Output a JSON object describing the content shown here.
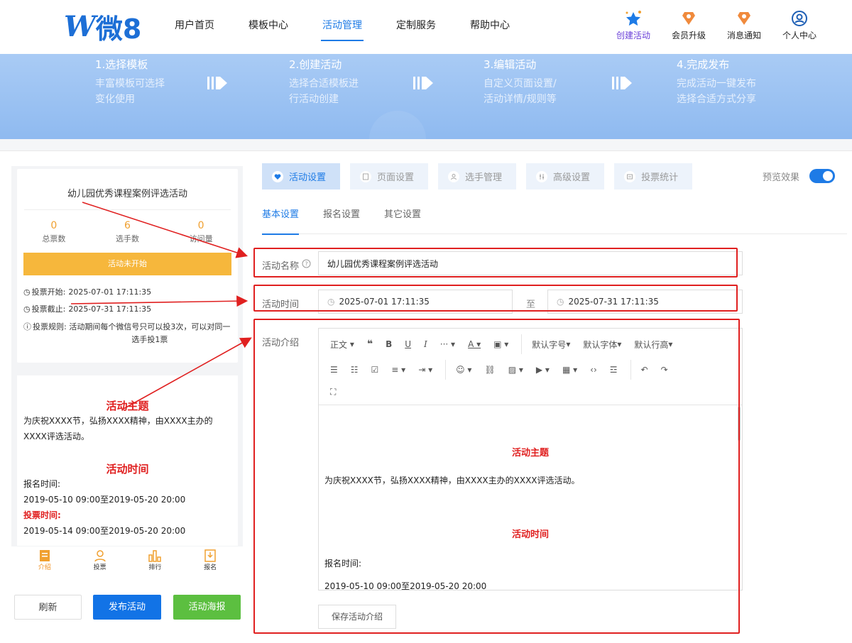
{
  "logo": {
    "mark": "W",
    "text": "微8"
  },
  "nav": [
    {
      "label": "用户首页"
    },
    {
      "label": "模板中心"
    },
    {
      "label": "活动管理"
    },
    {
      "label": "定制服务"
    },
    {
      "label": "帮助中心"
    }
  ],
  "top_icons": [
    {
      "label": "创建活动",
      "icon": "star-icon"
    },
    {
      "label": "会员升级",
      "icon": "badge-icon"
    },
    {
      "label": "消息通知",
      "icon": "badge-icon"
    },
    {
      "label": "个人中心",
      "icon": "user-icon"
    }
  ],
  "steps": [
    {
      "title": "1.选择模板",
      "l1": "丰富模板可选择",
      "l2": "变化使用"
    },
    {
      "title": "2.创建活动",
      "l1": "选择合适模板进",
      "l2": "行活动创建"
    },
    {
      "title": "3.编辑活动",
      "l1": "自定义页面设置/",
      "l2": "活动详情/规则等"
    },
    {
      "title": "4.完成发布",
      "l1": "完成活动一键发布",
      "l2": "选择合适方式分享"
    }
  ],
  "preview_card": {
    "title": "幼儿园优秀课程案例评选活动",
    "stats": [
      {
        "value": "0",
        "label": "总票数"
      },
      {
        "value": "6",
        "label": "选手数"
      },
      {
        "value": "0",
        "label": "访问量"
      }
    ],
    "status": "活动未开始",
    "vote_start_label": "投票开始:",
    "vote_start": "2025-07-01 17:11:35",
    "vote_end_label": "投票截止:",
    "vote_end": "2025-07-31 17:11:35",
    "rule_label": "投票规则:",
    "rule_text": "活动期间每个微信号只可以投3次，可以对同一选手投1票"
  },
  "preview_intro": {
    "h1": "活动主题",
    "p1": "为庆祝XXXX节，弘扬XXXX精神，由XXXX主办的XXXX评选活动。",
    "h2": "活动时间",
    "signup_label": "报名时间:",
    "signup_time": "2019-05-10 09:00至2019-05-20 20:00",
    "vote_label": "投票时间:",
    "vote_time": "2019-05-14 09:00至2019-05-20 20:00"
  },
  "bottom_nav": [
    {
      "label": "介绍"
    },
    {
      "label": "投票"
    },
    {
      "label": "排行"
    },
    {
      "label": "报名"
    }
  ],
  "buttons": {
    "refresh": "刷新",
    "publish": "发布活动",
    "poster": "活动海报"
  },
  "tabs": [
    {
      "label": "活动设置"
    },
    {
      "label": "页面设置"
    },
    {
      "label": "选手管理"
    },
    {
      "label": "高级设置"
    },
    {
      "label": "投票统计"
    }
  ],
  "preview_toggle": {
    "label": "预览效果",
    "on": true
  },
  "subtabs": [
    {
      "label": "基本设置"
    },
    {
      "label": "报名设置"
    },
    {
      "label": "其它设置"
    }
  ],
  "form": {
    "name_label": "活动名称",
    "name_value": "幼儿园优秀课程案例评选活动",
    "time_label": "活动时间",
    "start_time": "2025-07-01 17:11:35",
    "to_label": "至",
    "end_time": "2025-07-31 17:11:35",
    "intro_label": "活动介绍"
  },
  "editor": {
    "toolbar": {
      "paragraph": "正文",
      "font_size": "默认字号",
      "font_family": "默认字体",
      "line_height": "默认行高"
    },
    "content": {
      "h1": "活动主题",
      "p1": "为庆祝XXXX节，弘扬XXXX精神，由XXXX主办的XXXX评选活动。",
      "h2": "活动时间",
      "signup_label": "报名时间:",
      "signup_time": "2019-05-10 09:00至2019-05-20 20:00"
    },
    "save_label": "保存活动介绍"
  },
  "colors": {
    "accent": "#1e7be6",
    "annotation": "#e02020",
    "status": "#f6b73c",
    "poster": "#5cbf40"
  }
}
